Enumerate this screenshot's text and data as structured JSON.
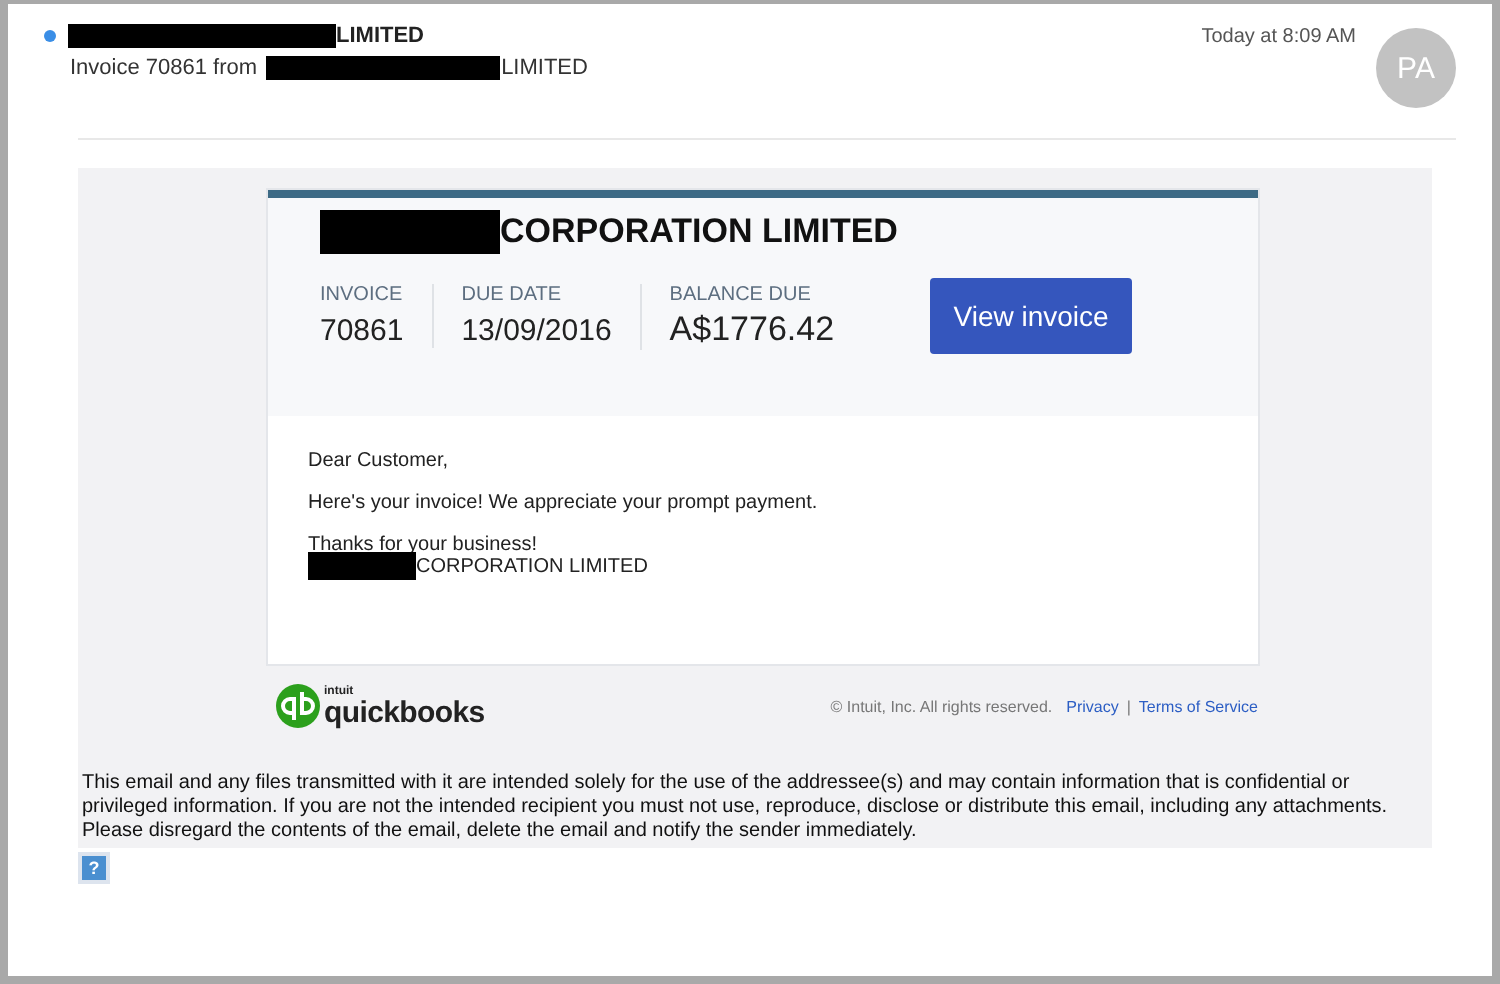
{
  "message": {
    "unread": true,
    "sender_suffix": "LIMITED",
    "subject_prefix": "Invoice 70861 from",
    "subject_suffix": "LIMITED",
    "time": "Today at 8:09 AM",
    "avatar": "PA"
  },
  "invoice_card": {
    "company_suffix": "CORPORATION LIMITED",
    "fields": [
      {
        "label": "INVOICE",
        "value": "70861"
      },
      {
        "label": "DUE DATE",
        "value": "13/09/2016"
      },
      {
        "label": "BALANCE DUE",
        "value": "A$1776.42"
      }
    ],
    "button": "View invoice",
    "greeting": "Dear Customer,",
    "body": "Here's your invoice! We appreciate your prompt payment.",
    "thanks": "Thanks for your business!",
    "signature_suffix": "CORPORATION LIMITED"
  },
  "footer": {
    "logo_small": "intuit",
    "logo": "quickbooks",
    "copyright": "© Intuit, Inc. All rights reserved.",
    "links": [
      "Privacy",
      "Terms of Service"
    ],
    "separator": "|"
  },
  "disclaimer": "This email and any files transmitted with it are intended solely for the use of the addressee(s) and may contain information that is confidential or privileged information. If you are not the intended recipient you must not use, reproduce, disclose or distribute this email, including any attachments. Please disregard the contents of the email, delete the email and notify the sender immediately.",
  "help_icon": "?"
}
